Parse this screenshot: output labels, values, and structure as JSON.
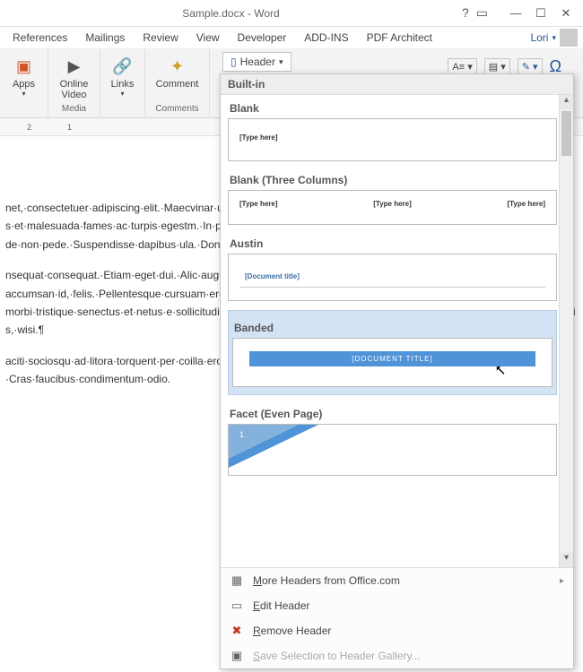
{
  "titlebar": {
    "title": "Sample.docx - Word"
  },
  "ribbonTabs": [
    "References",
    "Mailings",
    "Review",
    "View",
    "Developer",
    "ADD-INS",
    "PDF Architect"
  ],
  "user": "Lori",
  "ribbon": {
    "apps": "Apps",
    "onlineVideo": "Online\nVideo",
    "links": "Links",
    "comment": "Comment",
    "mediaLabel": "Media",
    "commentsLabel": "Comments",
    "headerBtn": "Header",
    "omega": "Ω"
  },
  "ruler": [
    "2",
    "1"
  ],
  "document": {
    "p1": "net,·consectetuer·adipiscing·elit.·Maecvinar·ultricies,·purus·lectus·malesuada·imperdiet·enim.·Fusce·est.·Vivamus·a·tus·et·malesuada·fames·ac·turpis·egestm.·In·porttitor.·Donec·laoreet·nonumm·vitae,·pretium·mattis,·nunc.·Mauris·eg·pede·non·pede.·Suspendisse·dapibus·ula.·Donec·hendrerit,·felis·et·imperdiebien.·¶",
    "p2": "nsequat·consequat.·Etiam·eget·dui.·Alic·augue.·Quisque·aliquam·tempor·magresuada·fames·ac·turpis·egestas.·Nunc·accumsan·id,·felis.·Pellentesque·cursuam·eros·tempus·arcu,·nec·vulputate·aVivamus·a·mi.·Morbi·neque.·Aliquamant·morbi·tristique·senectus·et·netus·e·sollicitudin·posuere,·metus·quam·iacu,·interdum·vel,·ultricies·vel,·faucibus·apus·quis,·wisi.¶",
    "p3": "aciti·sociosqu·ad·litora·torquent·per·coilla·eros.·Fusce·in·sapien·eu·purus·daparturient·montes,·nascetur·ridiculus·mus.·Cras·faucibus·condimentum·odio."
  },
  "dropdown": {
    "builtIn": "Built-in",
    "blank": "Blank",
    "typeHere": "[Type here]",
    "blank3": "Blank (Three Columns)",
    "austin": "Austin",
    "docTitle": "[Document title]",
    "banded": "Banded",
    "bandedText": "[DOCUMENT TITLE]",
    "facet": "Facet (Even Page)",
    "facetNum": "1",
    "moreHeaders": "More Headers from Office.com",
    "editHeader": "Edit Header",
    "removeHeader": "Remove Header",
    "saveSelection": "Save Selection to Header Gallery..."
  }
}
